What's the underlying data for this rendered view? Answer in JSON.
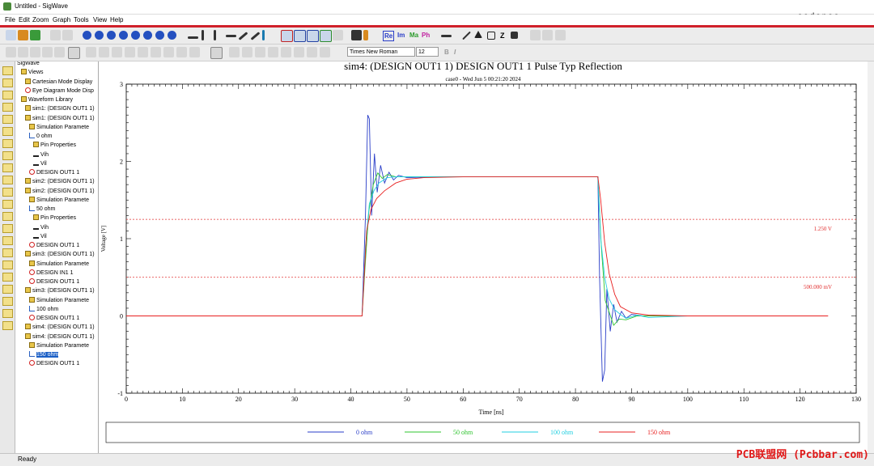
{
  "window": {
    "title": "Untitled - SigWave",
    "brand": "cadence"
  },
  "menu": [
    "File",
    "Edit",
    "Zoom",
    "Graph",
    "Tools",
    "View",
    "Help"
  ],
  "toolbar": {
    "re": "Re",
    "im": "Im",
    "ma": "Ma",
    "ph": "Ph",
    "font_name": "Times New Roman",
    "font_size": "12"
  },
  "tree": [
    {
      "label": "SigWave",
      "icon": "none"
    },
    {
      "label": "Views",
      "icon": "folder"
    },
    {
      "label": "Cartesian Mode Display",
      "icon": "folder"
    },
    {
      "label": "Eye Diagram Mode Disp",
      "icon": "no-icon"
    },
    {
      "label": "Waveform Library",
      "icon": "folder"
    },
    {
      "label": "sim1: (DESIGN OUT1 1)",
      "icon": "folder"
    },
    {
      "label": "sim1: (DESIGN OUT1 1)",
      "icon": "folder"
    },
    {
      "label": "Simulation Paramete",
      "icon": "folder"
    },
    {
      "label": "0 ohm",
      "icon": "wave"
    },
    {
      "label": "Pin Properties",
      "icon": "folder"
    },
    {
      "label": "Vih",
      "icon": "pin"
    },
    {
      "label": "Vil",
      "icon": "pin"
    },
    {
      "label": "DESIGN OUT1 1",
      "icon": "no-icon"
    },
    {
      "label": "sim2: (DESIGN OUT1 1)",
      "icon": "folder"
    },
    {
      "label": "sim2: (DESIGN OUT1 1)",
      "icon": "folder"
    },
    {
      "label": "Simulation Paramete",
      "icon": "folder"
    },
    {
      "label": "50 ohm",
      "icon": "wave"
    },
    {
      "label": "Pin Properties",
      "icon": "folder"
    },
    {
      "label": "Vih",
      "icon": "pin"
    },
    {
      "label": "Vil",
      "icon": "pin"
    },
    {
      "label": "DESIGN OUT1 1",
      "icon": "no-icon"
    },
    {
      "label": "sim3: (DESIGN OUT1 1)",
      "icon": "folder"
    },
    {
      "label": "Simulation Paramete",
      "icon": "folder"
    },
    {
      "label": "DESIGN IN1 1",
      "icon": "no-icon"
    },
    {
      "label": "DESIGN OUT1 1",
      "icon": "no-icon"
    },
    {
      "label": "sim3: (DESIGN OUT1 1)",
      "icon": "folder"
    },
    {
      "label": "Simulation Paramete",
      "icon": "folder"
    },
    {
      "label": "100 ohm",
      "icon": "wave"
    },
    {
      "label": "DESIGN OUT1 1",
      "icon": "no-icon"
    },
    {
      "label": "sim4: (DESIGN OUT1 1)",
      "icon": "folder"
    },
    {
      "label": "sim4: (DESIGN OUT1 1)",
      "icon": "folder"
    },
    {
      "label": "Simulation Paramete",
      "icon": "folder"
    },
    {
      "label": "150 ohm",
      "icon": "wave",
      "selected": true
    },
    {
      "label": "DESIGN OUT1 1",
      "icon": "no-icon"
    }
  ],
  "chart_data": {
    "type": "line",
    "title": "sim4: (DESIGN OUT1 1) DESIGN OUT1 1 Pulse Typ Reflection",
    "subtitle": "case0 - Wed Jun  5 00:21:20 2024",
    "xlabel": "Time [ns]",
    "ylabel": "Voltage [V]",
    "xlim": [
      0,
      130
    ],
    "ylim": [
      -1,
      3
    ],
    "xticks": [
      0,
      10,
      20,
      30,
      40,
      50,
      60,
      70,
      80,
      90,
      100,
      110,
      120,
      130
    ],
    "yticks": [
      -1,
      0,
      1,
      2,
      3
    ],
    "thresholds": [
      {
        "value": 1.25,
        "label": "1.250 V",
        "color": "#e23030"
      },
      {
        "value": 0.5,
        "label": "500.000 mV",
        "color": "#e23030"
      }
    ],
    "legend_position": "bottom",
    "series": [
      {
        "name": "0 ohm",
        "color": "#2a3ec8",
        "points": [
          [
            0,
            0
          ],
          [
            42,
            0
          ],
          [
            42.6,
            1.3
          ],
          [
            43,
            2.6
          ],
          [
            43.3,
            2.55
          ],
          [
            43.7,
            1.3
          ],
          [
            44.2,
            2.1
          ],
          [
            44.7,
            1.6
          ],
          [
            45.3,
            1.95
          ],
          [
            46,
            1.72
          ],
          [
            46.8,
            1.86
          ],
          [
            47.6,
            1.76
          ],
          [
            48.5,
            1.82
          ],
          [
            50,
            1.79
          ],
          [
            55,
            1.8
          ],
          [
            84,
            1.8
          ],
          [
            84.3,
            0.5
          ],
          [
            84.8,
            -0.85
          ],
          [
            85.2,
            -0.7
          ],
          [
            85.6,
            0.35
          ],
          [
            86.2,
            -0.2
          ],
          [
            86.8,
            0.15
          ],
          [
            87.4,
            -0.08
          ],
          [
            88.2,
            0.06
          ],
          [
            89,
            -0.03
          ],
          [
            90,
            0.02
          ],
          [
            92,
            0
          ],
          [
            100,
            0
          ]
        ]
      },
      {
        "name": "50 ohm",
        "color": "#2fc42f",
        "points": [
          [
            0,
            0
          ],
          [
            42,
            0
          ],
          [
            42.5,
            0.6
          ],
          [
            43.2,
            1.35
          ],
          [
            44,
            1.7
          ],
          [
            44.8,
            1.85
          ],
          [
            45.6,
            1.78
          ],
          [
            46.5,
            1.83
          ],
          [
            48,
            1.8
          ],
          [
            55,
            1.8
          ],
          [
            84,
            1.8
          ],
          [
            84.6,
            0.9
          ],
          [
            85.3,
            0.2
          ],
          [
            86,
            0.05
          ],
          [
            86.8,
            -0.12
          ],
          [
            87.8,
            -0.04
          ],
          [
            89,
            -0.05
          ],
          [
            91,
            0
          ],
          [
            100,
            0
          ]
        ]
      },
      {
        "name": "100 ohm",
        "color": "#22cfe0",
        "points": [
          [
            0,
            0
          ],
          [
            42,
            0
          ],
          [
            42.6,
            0.9
          ],
          [
            43.3,
            1.45
          ],
          [
            44.1,
            1.62
          ],
          [
            45,
            1.72
          ],
          [
            46.5,
            1.79
          ],
          [
            48,
            1.8
          ],
          [
            55,
            1.8
          ],
          [
            84,
            1.8
          ],
          [
            84.5,
            1.0
          ],
          [
            85.2,
            0.5
          ],
          [
            86,
            0.22
          ],
          [
            87,
            0.08
          ],
          [
            88,
            0.02
          ],
          [
            89,
            -0.03
          ],
          [
            91,
            0.01
          ],
          [
            93,
            -0.02
          ],
          [
            100,
            0
          ]
        ]
      },
      {
        "name": "150 ohm",
        "color": "#e82020",
        "points": [
          [
            0,
            0
          ],
          [
            42,
            0
          ],
          [
            42.8,
            1.1
          ],
          [
            43.6,
            1.38
          ],
          [
            44.6,
            1.52
          ],
          [
            46,
            1.62
          ],
          [
            48,
            1.72
          ],
          [
            50,
            1.77
          ],
          [
            53,
            1.79
          ],
          [
            60,
            1.8
          ],
          [
            84,
            1.8
          ],
          [
            84.5,
            1.5
          ],
          [
            85.2,
            0.95
          ],
          [
            86,
            0.55
          ],
          [
            87,
            0.28
          ],
          [
            88,
            0.12
          ],
          [
            90,
            0.04
          ],
          [
            93,
            0.01
          ],
          [
            100,
            0
          ],
          [
            125,
            0
          ]
        ]
      }
    ]
  }
}
